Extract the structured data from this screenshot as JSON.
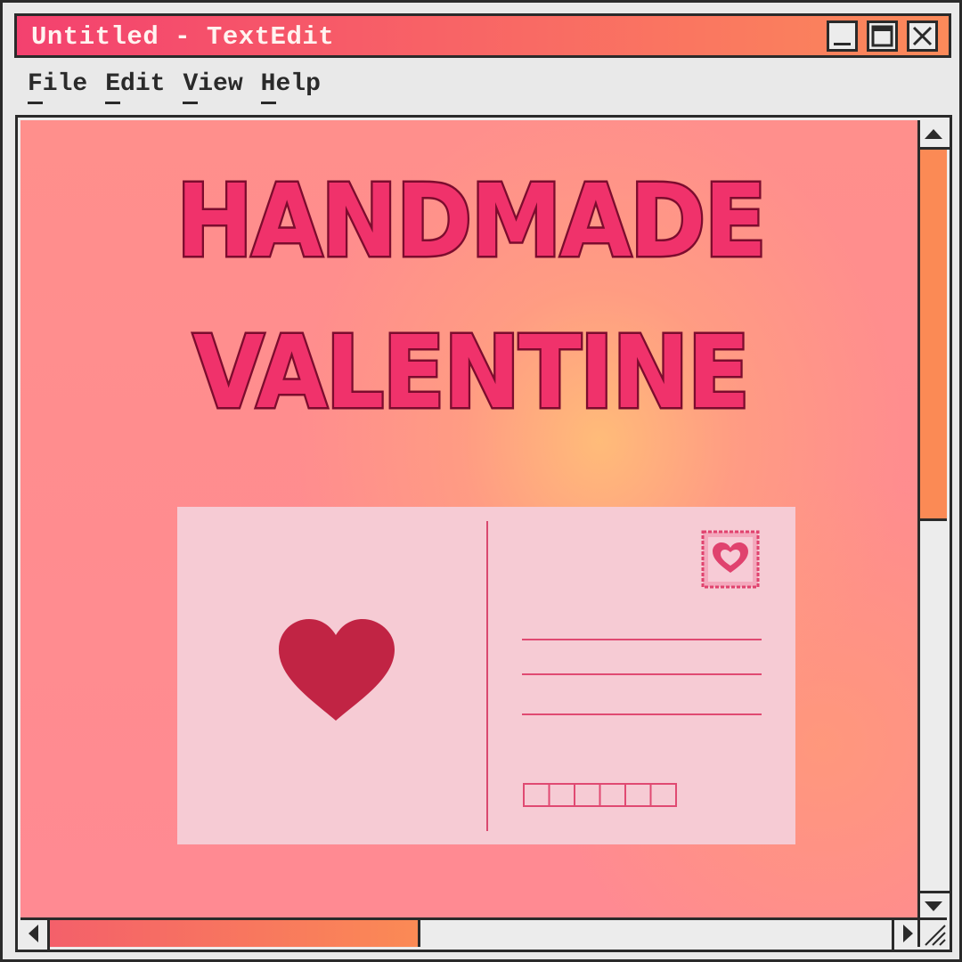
{
  "window": {
    "title": "Untitled - TextEdit",
    "controls": [
      "minimize-icon",
      "maximize-icon",
      "close-icon"
    ]
  },
  "menubar": {
    "items": [
      {
        "label": "File"
      },
      {
        "label": "Edit"
      },
      {
        "label": "View"
      },
      {
        "label": "Help"
      }
    ]
  },
  "document": {
    "headline_line1": "HANDMADE",
    "headline_line2": "VALENTINE",
    "postcard": {
      "front_icon": "heart-icon",
      "stamp_icon": "heart-stamp-icon",
      "address_lines": 3,
      "postal_code_boxes": 6
    }
  },
  "scrollbars": {
    "vertical_position": 0.0,
    "horizontal_position": 0.0
  },
  "colors": {
    "title_gradient_start": "#f3416f",
    "title_gradient_end": "#fb8a5a",
    "accent_pink": "#f0326b",
    "heart_red": "#c12444",
    "postcard_bg": "#f6cbd4",
    "line_pink": "#e04a72",
    "outline": "#2a2a2a"
  }
}
